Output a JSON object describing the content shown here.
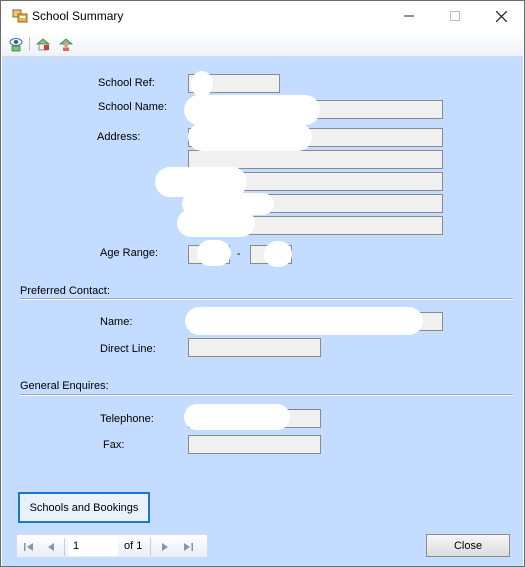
{
  "window": {
    "title": "School Summary",
    "icons": {
      "app": "school-summary-app-icon",
      "minimize": "minimize-icon",
      "maximize": "maximize-icon",
      "close": "close-icon"
    }
  },
  "toolbar": {
    "icons": [
      "view-eye-icon",
      "add-school-icon",
      "person-school-icon"
    ]
  },
  "form": {
    "school_ref_label": "School Ref:",
    "school_name_label": "School Name:",
    "address_label": "Address:",
    "age_range_label": "Age Range:",
    "age_range_separator": "-",
    "preferred_contact": {
      "heading": "Preferred Contact:",
      "name_label": "Name:",
      "direct_line_label": "Direct Line:"
    },
    "general_enquires": {
      "heading": "General Enquires:",
      "telephone_label": "Telephone:",
      "fax_label": "Fax:"
    },
    "schools_bookings_button": "Schools and Bookings"
  },
  "statusbar": {
    "page_value": "1",
    "of_text": "of 1",
    "nav_icons": [
      "first-page-icon",
      "prev-page-icon",
      "next-page-icon",
      "last-page-icon"
    ],
    "close_button": "Close"
  },
  "colors": {
    "form_background": "#c3dcff",
    "field_background": "#f0f0f0",
    "accent_border": "#1a77c9"
  }
}
